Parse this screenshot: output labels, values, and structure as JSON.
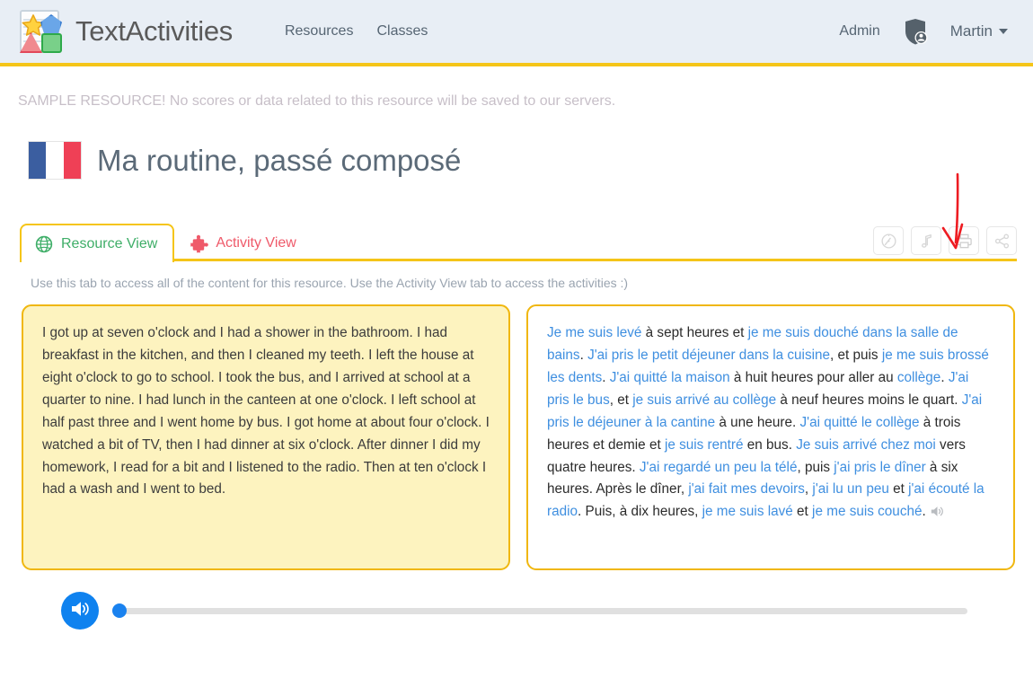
{
  "header": {
    "brand_name": "TextActivities",
    "logo_icon": "shapes-document-logo",
    "nav": [
      {
        "label": "Resources",
        "icon": ""
      },
      {
        "label": "Classes",
        "icon": ""
      }
    ],
    "admin_label": "Admin",
    "avatar_icon": "shield-user-avatar-icon",
    "user_name": "Martin",
    "caret_icon": "chevron-down-icon",
    "accent_color": "#f5c518",
    "background_color": "#e8eef5"
  },
  "banner": {
    "text": "SAMPLE RESOURCE! No scores or data related to this resource will be saved to our servers."
  },
  "title": {
    "flag_icon": "french-flag-icon",
    "flag_colors": [
      "#3b5ea0",
      "#ffffff",
      "#ef4056"
    ],
    "text": "Ma routine, passé composé"
  },
  "tabs": [
    {
      "label": "Resource View",
      "icon": "globe-icon",
      "active": true,
      "color": "#3fae68"
    },
    {
      "label": "Activity View",
      "icon": "puzzle-piece-icon",
      "active": false,
      "color": "#ef5a6a"
    }
  ],
  "toolbar": {
    "buttons": [
      {
        "name": "speed-button",
        "icon": "speedometer-icon"
      },
      {
        "name": "music-button",
        "icon": "music-note-icon"
      },
      {
        "name": "print-button",
        "icon": "printer-icon"
      },
      {
        "name": "share-button",
        "icon": "share-icon"
      }
    ],
    "annotation": {
      "icon": "red-arrow-annotation",
      "color": "#ee1c22",
      "points_to": "print-button"
    }
  },
  "hint": {
    "text": "Use this tab to access all of the content for this resource. Use the Activity View tab to access the activities :)"
  },
  "panels": {
    "english": {
      "text": "I got up at seven o'clock and I had a shower in the bathroom. I had breakfast in the kitchen, and then I cleaned my teeth. I left the house at eight o'clock to go to school. I took the bus, and I arrived at school at a quarter to nine. I had lunch in the canteen at one o'clock. I left school at half past three and I went home by bus. I got home at about four o'clock. I watched a bit of TV, then I had dinner at six o'clock. After dinner I did my homework, I read for a bit and I listened to the radio. Then at ten o'clock I had a wash and I went to bed.",
      "background_color": "#fdf3bf",
      "border_color": "#f0b70f"
    },
    "french": {
      "highlight_color": "#3f8fe0",
      "background_color": "#ffffff",
      "border_color": "#f0b70f",
      "speaker_icon": "speaker-icon",
      "segments": [
        {
          "t": "Je me suis levé",
          "h": true
        },
        {
          "t": " à sept heures et ",
          "h": false
        },
        {
          "t": "je me suis douché dans la salle de bains",
          "h": true
        },
        {
          "t": ". ",
          "h": false
        },
        {
          "t": "J'ai pris le petit déjeuner dans la cuisine",
          "h": true
        },
        {
          "t": ", et puis ",
          "h": false
        },
        {
          "t": "je me suis brossé les dents",
          "h": true
        },
        {
          "t": ". ",
          "h": false
        },
        {
          "t": "J'ai quitté la maison",
          "h": true
        },
        {
          "t": " à huit heures pour aller au ",
          "h": false
        },
        {
          "t": "collège",
          "h": true
        },
        {
          "t": ". ",
          "h": false
        },
        {
          "t": "J'ai pris le bus",
          "h": true
        },
        {
          "t": ", et ",
          "h": false
        },
        {
          "t": "je suis arrivé au collège",
          "h": true
        },
        {
          "t": " à neuf heures moins le quart. ",
          "h": false
        },
        {
          "t": "J'ai pris le déjeuner à la cantine",
          "h": true
        },
        {
          "t": " à une heure. ",
          "h": false
        },
        {
          "t": "J'ai quitté le collège",
          "h": true
        },
        {
          "t": " à trois heures et demie et ",
          "h": false
        },
        {
          "t": "je suis rentré",
          "h": true
        },
        {
          "t": " en bus. ",
          "h": false
        },
        {
          "t": "Je suis arrivé chez moi",
          "h": true
        },
        {
          "t": " vers quatre heures. ",
          "h": false
        },
        {
          "t": "J'ai regardé un peu la télé",
          "h": true
        },
        {
          "t": ", puis ",
          "h": false
        },
        {
          "t": "j'ai pris le dîner",
          "h": true
        },
        {
          "t": " à six heures. Après le dîner, ",
          "h": false
        },
        {
          "t": "j'ai fait mes devoirs",
          "h": true
        },
        {
          "t": ", ",
          "h": false
        },
        {
          "t": "j'ai lu un peu",
          "h": true
        },
        {
          "t": " et ",
          "h": false
        },
        {
          "t": "j'ai écouté la radio",
          "h": true
        },
        {
          "t": ". Puis, à dix heures, ",
          "h": false
        },
        {
          "t": "je me suis lavé",
          "h": true
        },
        {
          "t": " et ",
          "h": false
        },
        {
          "t": "je me suis couché",
          "h": true
        },
        {
          "t": ".",
          "h": false
        }
      ]
    }
  },
  "player": {
    "play_icon": "speaker-play-icon",
    "play_color": "#0f82ef",
    "progress_percent": 0,
    "track_color": "#e0e0e0",
    "thumb_color": "#1a82ef"
  }
}
